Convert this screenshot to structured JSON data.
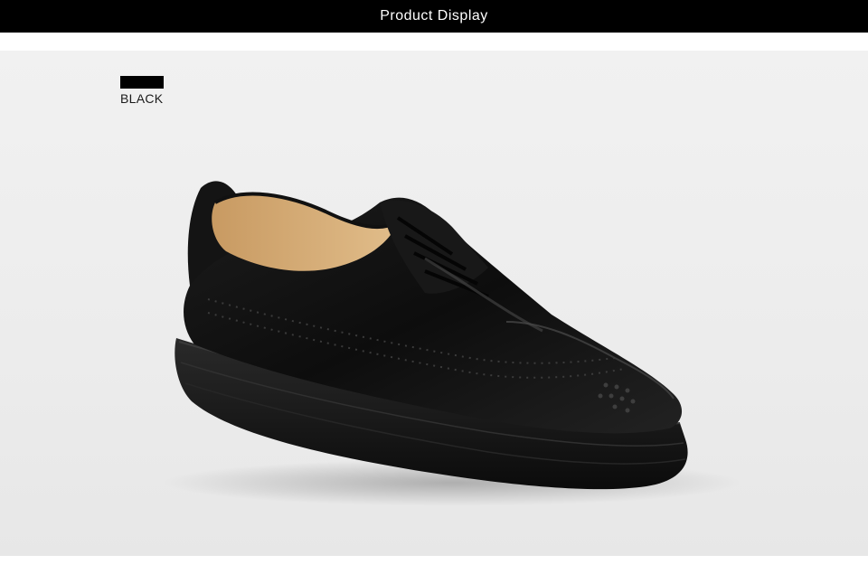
{
  "header": {
    "title": "Product Display"
  },
  "product": {
    "color_label": "BLACK",
    "swatch_color": "#000000",
    "image_subject": "black-leather-brogue-platform-shoe"
  },
  "colors": {
    "header_bg": "#000000",
    "header_text": "#ffffff",
    "panel_bg": "#efefef"
  }
}
